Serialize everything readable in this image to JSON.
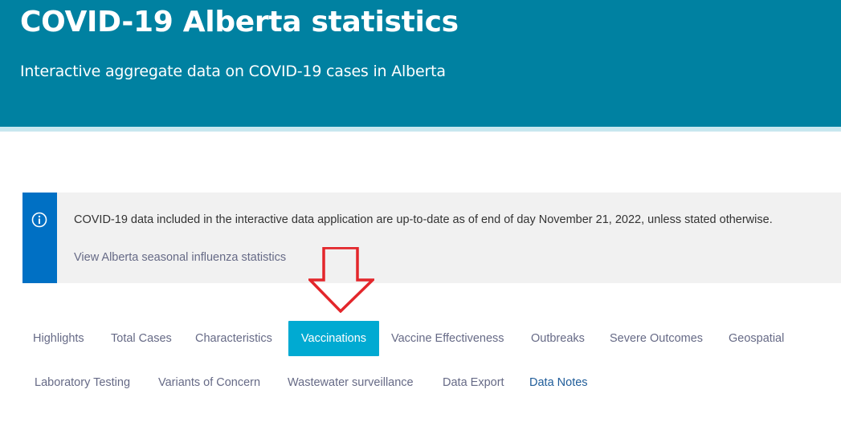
{
  "header": {
    "title": "COVID-19 Alberta statistics",
    "subtitle": "Interactive aggregate data on COVID-19 cases in Alberta"
  },
  "notice": {
    "icon": "info-icon",
    "text": "COVID-19 data included in the interactive data application are up-to-date as of end of day November 21, 2022, unless stated otherwise.",
    "link_label": "View Alberta seasonal influenza statistics"
  },
  "annotation": {
    "icon": "down-arrow-icon",
    "color": "#e3262b"
  },
  "tabs": {
    "row1": [
      {
        "label": "Highlights"
      },
      {
        "label": "Total Cases"
      },
      {
        "label": "Characteristics"
      },
      {
        "label": "Vaccinations",
        "active": true
      },
      {
        "label": "Vaccine Effectiveness"
      },
      {
        "label": "Outbreaks"
      },
      {
        "label": "Severe Outcomes"
      },
      {
        "label": "Geospatial"
      }
    ],
    "row2": [
      {
        "label": "Laboratory Testing"
      },
      {
        "label": "Variants of Concern"
      },
      {
        "label": "Wastewater surveillance"
      },
      {
        "label": "Data Export"
      },
      {
        "label": "Data Notes"
      }
    ]
  },
  "colors": {
    "header_bg": "#0081a1",
    "notice_bar": "#0070c4",
    "active_tab": "#00aad2",
    "tab_text": "#666a86",
    "data_notes_text": "#1f5c99"
  }
}
